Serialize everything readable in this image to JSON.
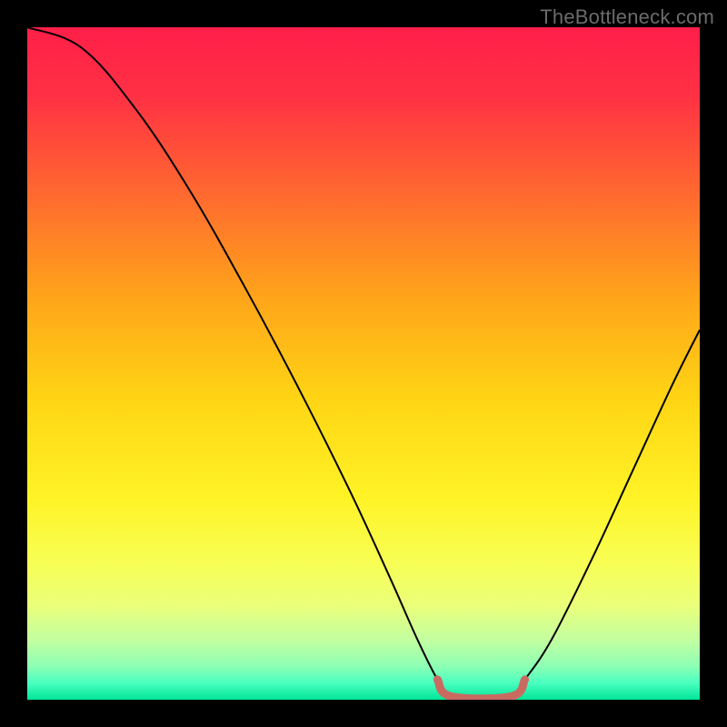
{
  "watermark": "TheBottleneck.com",
  "colors": {
    "frame": "#000000",
    "curve_stroke": "#000000",
    "trough_stroke": "#c96a61",
    "watermark_text": "#6b6b6b",
    "gradient_stops": [
      {
        "offset": 0.0,
        "color": "#ff1f49"
      },
      {
        "offset": 0.1,
        "color": "#ff3044"
      },
      {
        "offset": 0.25,
        "color": "#ff6a2f"
      },
      {
        "offset": 0.4,
        "color": "#ffa41a"
      },
      {
        "offset": 0.55,
        "color": "#ffd414"
      },
      {
        "offset": 0.7,
        "color": "#fff326"
      },
      {
        "offset": 0.8,
        "color": "#f7ff56"
      },
      {
        "offset": 0.86,
        "color": "#eaff7a"
      },
      {
        "offset": 0.91,
        "color": "#c4ffa0"
      },
      {
        "offset": 0.95,
        "color": "#8dffb4"
      },
      {
        "offset": 0.975,
        "color": "#4affc0"
      },
      {
        "offset": 1.0,
        "color": "#00e597"
      }
    ]
  },
  "chart_data": {
    "type": "line",
    "title": "",
    "xlabel": "",
    "ylabel": "",
    "xlim": [
      0,
      100
    ],
    "ylim": [
      0,
      100
    ],
    "series": [
      {
        "name": "bottleneck-curve",
        "points": [
          {
            "x": 0,
            "y": 100
          },
          {
            "x": 8,
            "y": 97
          },
          {
            "x": 16,
            "y": 88
          },
          {
            "x": 24,
            "y": 76
          },
          {
            "x": 32,
            "y": 62
          },
          {
            "x": 40,
            "y": 47
          },
          {
            "x": 48,
            "y": 31
          },
          {
            "x": 54,
            "y": 18
          },
          {
            "x": 58,
            "y": 9
          },
          {
            "x": 61,
            "y": 3
          },
          {
            "x": 63,
            "y": 0.5
          },
          {
            "x": 72,
            "y": 0.5
          },
          {
            "x": 74,
            "y": 3
          },
          {
            "x": 78,
            "y": 9
          },
          {
            "x": 84,
            "y": 21
          },
          {
            "x": 90,
            "y": 34
          },
          {
            "x": 96,
            "y": 47
          },
          {
            "x": 100,
            "y": 55
          }
        ]
      },
      {
        "name": "trough-highlight",
        "points": [
          {
            "x": 61,
            "y": 3
          },
          {
            "x": 63,
            "y": 0.5
          },
          {
            "x": 72,
            "y": 0.5
          },
          {
            "x": 74,
            "y": 3
          }
        ]
      }
    ]
  }
}
